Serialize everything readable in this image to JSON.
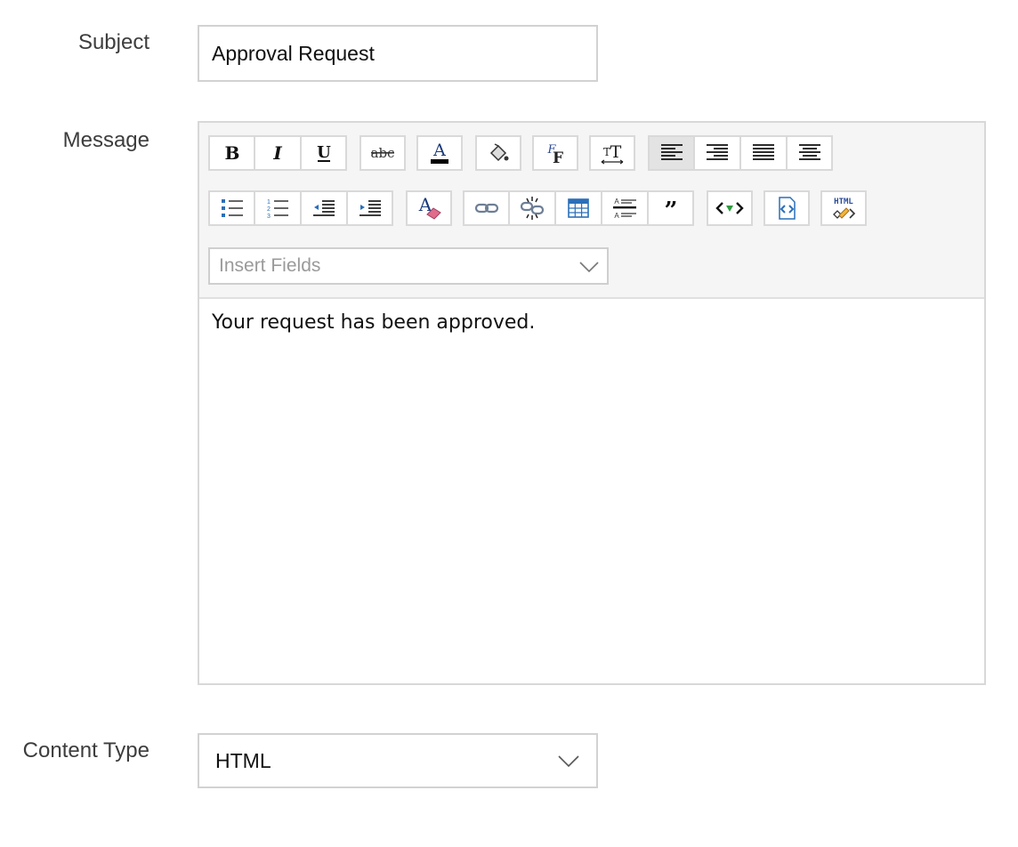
{
  "subject": {
    "label": "Subject",
    "value": "Approval Request"
  },
  "message": {
    "label": "Message",
    "toolbar_row1": [
      "bold-icon",
      "italic-icon",
      "underline-icon",
      "strikethrough-icon",
      "font-color-icon",
      "background-color-icon",
      "font-family-icon",
      "font-size-icon",
      "align-left-icon",
      "align-right-icon",
      "justify-icon",
      "align-center-icon"
    ],
    "toolbar_row2": [
      "bulleted-list-icon",
      "numbered-list-icon",
      "outdent-icon",
      "indent-icon",
      "clear-format-icon",
      "link-icon",
      "unlink-icon",
      "table-icon",
      "line-spacing-icon",
      "blockquote-icon",
      "embed-code-icon",
      "insert-html-icon",
      "html-source-icon"
    ],
    "insert_fields_placeholder": "Insert Fields",
    "body": "Your request has been approved."
  },
  "content_type": {
    "label": "Content Type",
    "selected": "HTML"
  },
  "colors": {
    "icon_dark": "#222222",
    "icon_blue": "#2a6fb8",
    "icon_green": "#2e9a3e",
    "icon_pink": "#e06b8a",
    "border": "#d2d2d2",
    "toolbar_bg": "#f5f5f5"
  }
}
